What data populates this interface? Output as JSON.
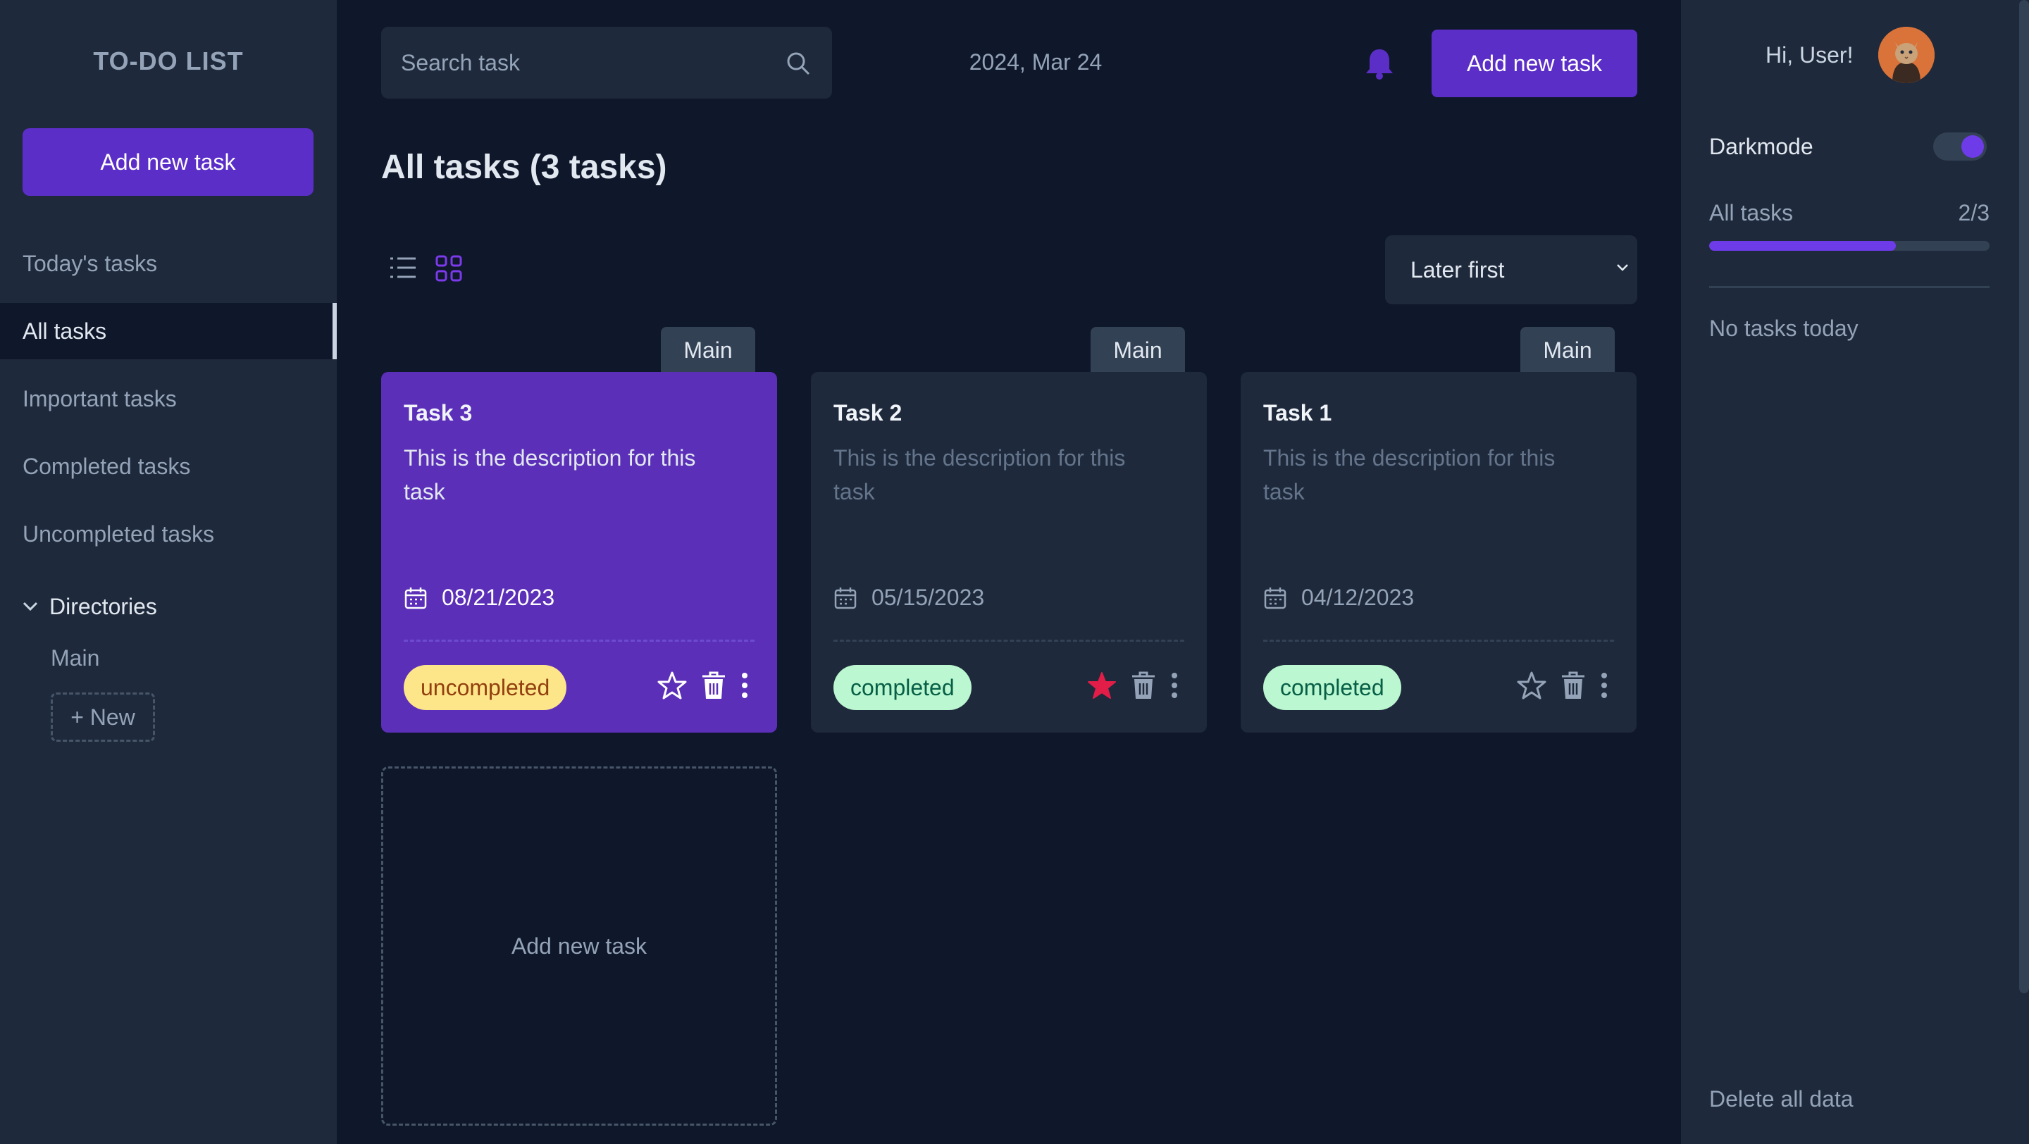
{
  "app": {
    "brand": "TO-DO LIST"
  },
  "sidebar": {
    "add_label": "Add new task",
    "items": [
      {
        "label": "Today's tasks",
        "active": false
      },
      {
        "label": "All tasks",
        "active": true
      },
      {
        "label": "Important tasks",
        "active": false
      },
      {
        "label": "Completed tasks",
        "active": false
      },
      {
        "label": "Uncompleted tasks",
        "active": false
      }
    ],
    "directories": {
      "label": "Directories",
      "items": [
        "Main"
      ],
      "new_label": "+ New"
    }
  },
  "header": {
    "search_placeholder": "Search task",
    "date": "2024, Mar 24",
    "add_label": "Add new task"
  },
  "main": {
    "title": "All tasks (3 tasks)",
    "sort": {
      "selected": "Later first"
    },
    "tasks": [
      {
        "dir": "Main",
        "title": "Task 3",
        "description": "This is the description for this task",
        "date": "08/21/2023",
        "status": "uncompleted",
        "important": false
      },
      {
        "dir": "Main",
        "title": "Task 2",
        "description": "This is the description for this task",
        "date": "05/15/2023",
        "status": "completed",
        "important": true
      },
      {
        "dir": "Main",
        "title": "Task 1",
        "description": "This is the description for this task",
        "date": "04/12/2023",
        "status": "completed",
        "important": false
      }
    ],
    "add_card_label": "Add new task"
  },
  "right": {
    "greeting": "Hi, User!",
    "darkmode_label": "Darkmode",
    "darkmode_on": true,
    "progress": {
      "label": "All tasks",
      "count": "2/3",
      "fraction": 0.667
    },
    "no_tasks": "No tasks today",
    "delete_label": "Delete all data"
  },
  "colors": {
    "accent": "#5b2fc7",
    "background": "#0f172a",
    "panel": "#1e293b",
    "important_star": "#e11d48",
    "uncompleted_badge": "#fde68a",
    "completed_badge": "#bbf7d0"
  }
}
